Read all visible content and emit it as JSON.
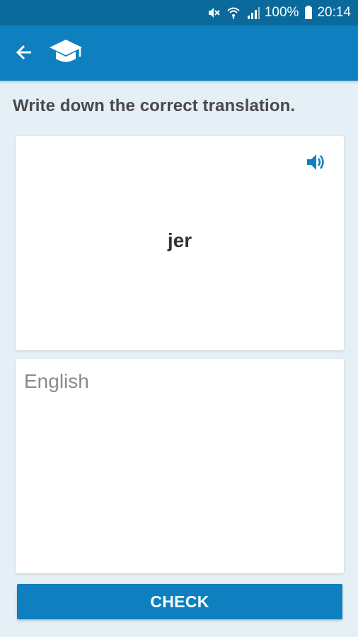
{
  "status_bar": {
    "icons": [
      "mute-icon",
      "wifi-icon",
      "signal-icon",
      "battery-icon"
    ],
    "battery": "100%",
    "time": "20:14"
  },
  "app_bar": {
    "back_icon": "arrow-back-icon",
    "logo_icon": "graduation-cap-icon",
    "background": "#0e80bf"
  },
  "exercise": {
    "prompt": "Write down the correct translation.",
    "word": "jer",
    "speaker_icon": "speaker-icon",
    "answer_placeholder": "English",
    "answer_value": ""
  },
  "actions": {
    "check_label": "CHECK"
  },
  "colors": {
    "primary": "#0e80bf",
    "status_bar": "#0a6a9c",
    "background": "#e4eff6"
  }
}
